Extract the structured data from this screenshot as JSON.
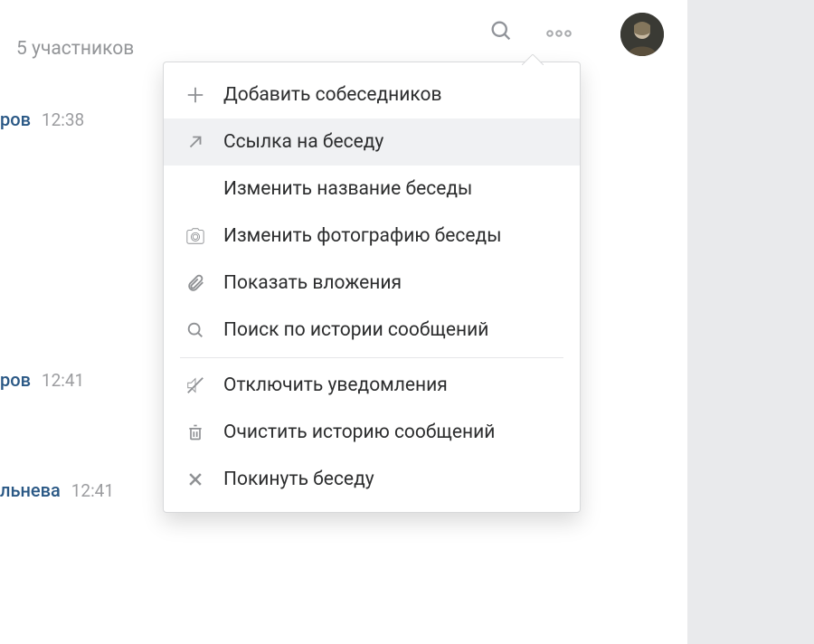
{
  "header": {
    "participants": "5 участников"
  },
  "messages": [
    {
      "name_fragment": "ров",
      "time": "12:38"
    },
    {
      "name_fragment": "ров",
      "time": "12:41"
    },
    {
      "name_fragment": "льнева",
      "time": "12:41"
    }
  ],
  "dropdown": {
    "items": [
      {
        "icon": "plus-icon",
        "label": "Добавить собеседников"
      },
      {
        "icon": "arrow-up-right-icon",
        "label": "Ссылка на беседу",
        "hovered": true
      },
      {
        "icon": "pencil-icon",
        "label": "Изменить название беседы"
      },
      {
        "icon": "camera-icon",
        "label": "Изменить фотографию беседы"
      },
      {
        "icon": "paperclip-icon",
        "label": "Показать вложения"
      },
      {
        "icon": "search-icon",
        "label": "Поиск по истории сообщений"
      },
      {
        "separator": true
      },
      {
        "icon": "mute-icon",
        "label": "Отключить уведомления"
      },
      {
        "icon": "trash-icon",
        "label": "Очистить историю сообщений"
      },
      {
        "icon": "close-icon",
        "label": "Покинуть беседу"
      }
    ]
  }
}
